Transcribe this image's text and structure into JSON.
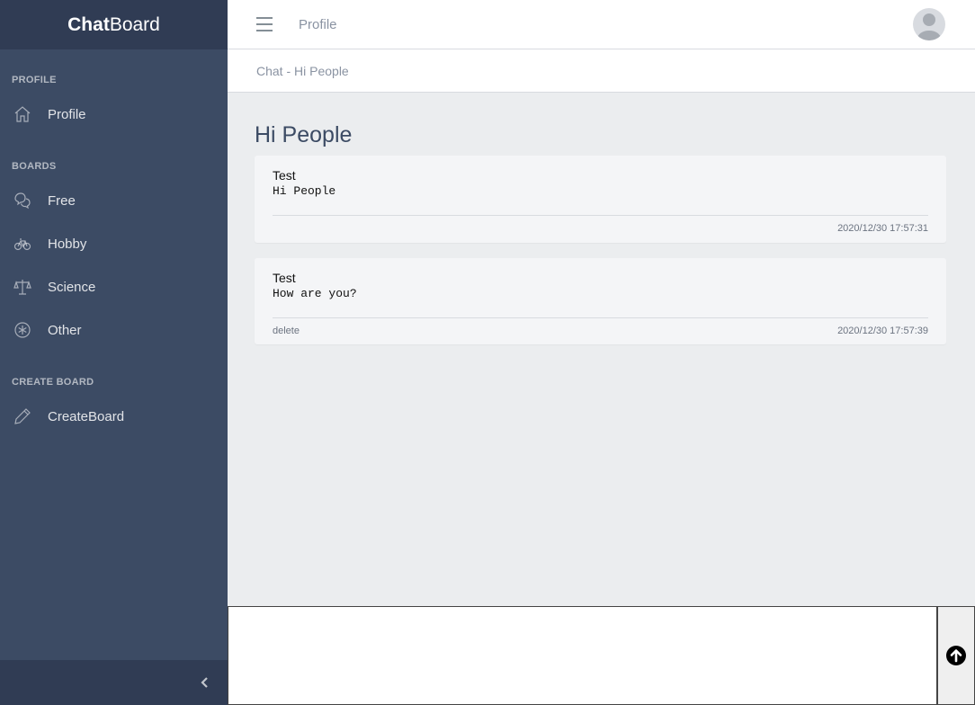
{
  "brand": {
    "bold": "Chat",
    "light": "Board"
  },
  "sidebar": {
    "sections": [
      {
        "title": "PROFILE",
        "items": [
          {
            "label": "Profile",
            "icon": "home-icon"
          }
        ]
      },
      {
        "title": "BOARDS",
        "items": [
          {
            "label": "Free",
            "icon": "chat-bubbles-icon"
          },
          {
            "label": "Hobby",
            "icon": "bicycle-icon"
          },
          {
            "label": "Science",
            "icon": "balance-scale-icon"
          },
          {
            "label": "Other",
            "icon": "asterisk-circle-icon"
          }
        ]
      },
      {
        "title": "CREATE BOARD",
        "items": [
          {
            "label": "CreateBoard",
            "icon": "pencil-icon"
          }
        ]
      }
    ],
    "footer_icon": "chevron-left-icon"
  },
  "header": {
    "link": "Profile",
    "menu_icon": "hamburger-icon",
    "avatar_icon": "user-avatar-icon"
  },
  "breadcrumb": "Chat - Hi People",
  "board": {
    "title": "Hi People",
    "messages": [
      {
        "author": "Test",
        "text": "Hi People",
        "timestamp": "2020/12/30 17:57:31",
        "delete": ""
      },
      {
        "author": "Test",
        "text": "How are you?",
        "timestamp": "2020/12/30 17:57:39",
        "delete": "delete"
      }
    ]
  },
  "compose": {
    "value": "",
    "send_icon": "arrow-up-circle-icon"
  },
  "colors": {
    "sidebar": "#3c4b64",
    "sidebar_dark": "#303c54",
    "background": "#ebedef"
  }
}
